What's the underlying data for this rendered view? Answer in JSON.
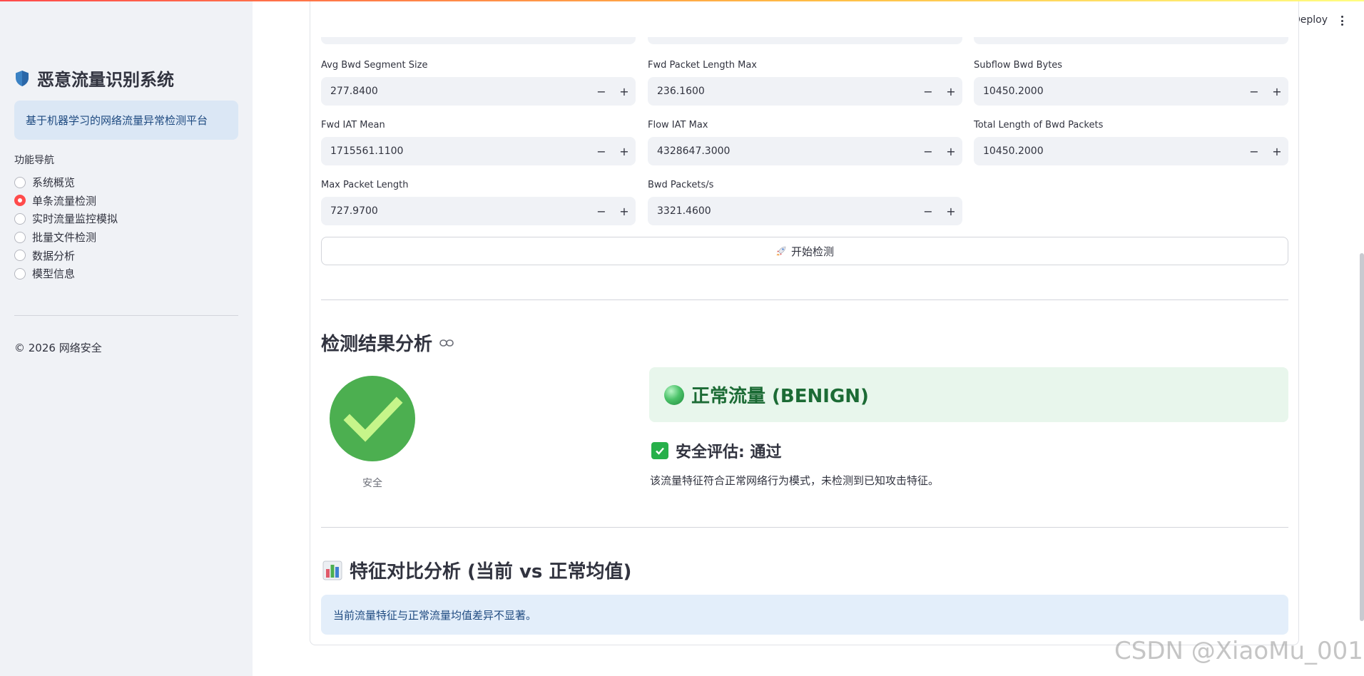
{
  "sidebar": {
    "title": "恶意流量识别系统",
    "subtitle": "基于机器学习的网络流量异常检测平台",
    "nav_label": "功能导航",
    "nav_items": [
      {
        "label": "系统概览"
      },
      {
        "label": "单条流量检测"
      },
      {
        "label": "实时流量监控模拟"
      },
      {
        "label": "批量文件检测"
      },
      {
        "label": "数据分析"
      },
      {
        "label": "模型信息"
      }
    ],
    "selected_index": 1,
    "footer": "© 2026 网络安全"
  },
  "header": {
    "deploy_label": "Deploy"
  },
  "fields": [
    {
      "label": "Avg Bwd Segment Size",
      "value": "277.8400"
    },
    {
      "label": "Fwd Packet Length Max",
      "value": "236.1600"
    },
    {
      "label": "Subflow Bwd Bytes",
      "value": "10450.2000"
    },
    {
      "label": "Fwd IAT Mean",
      "value": "1715561.1100"
    },
    {
      "label": "Flow IAT Max",
      "value": "4328647.3000"
    },
    {
      "label": "Total Length of Bwd Packets",
      "value": "10450.2000"
    },
    {
      "label": "Max Packet Length",
      "value": "727.9700"
    },
    {
      "label": "Bwd Packets/s",
      "value": "3321.4600"
    }
  ],
  "stepper": {
    "minus": "−",
    "plus": "+"
  },
  "start_button": {
    "label": "开始检测"
  },
  "result": {
    "heading": "检测结果分析",
    "gauge_label": "安全",
    "verdict": "正常流量 (BENIGN)",
    "assessment": "安全评估: 通过",
    "description": "该流量特征符合正常网络行为模式，未检测到已知攻击特征。"
  },
  "compare": {
    "heading": "特征对比分析 (当前 vs 正常均值)",
    "info": "当前流量特征与正常流量均值差异不显著。"
  },
  "watermark": "CSDN @XiaoMu_001",
  "colors": {
    "accent": "#ff4b4b",
    "success": "#27b04a",
    "benign_bg": "#e8f6ec",
    "info_bg": "#e3eefa"
  }
}
